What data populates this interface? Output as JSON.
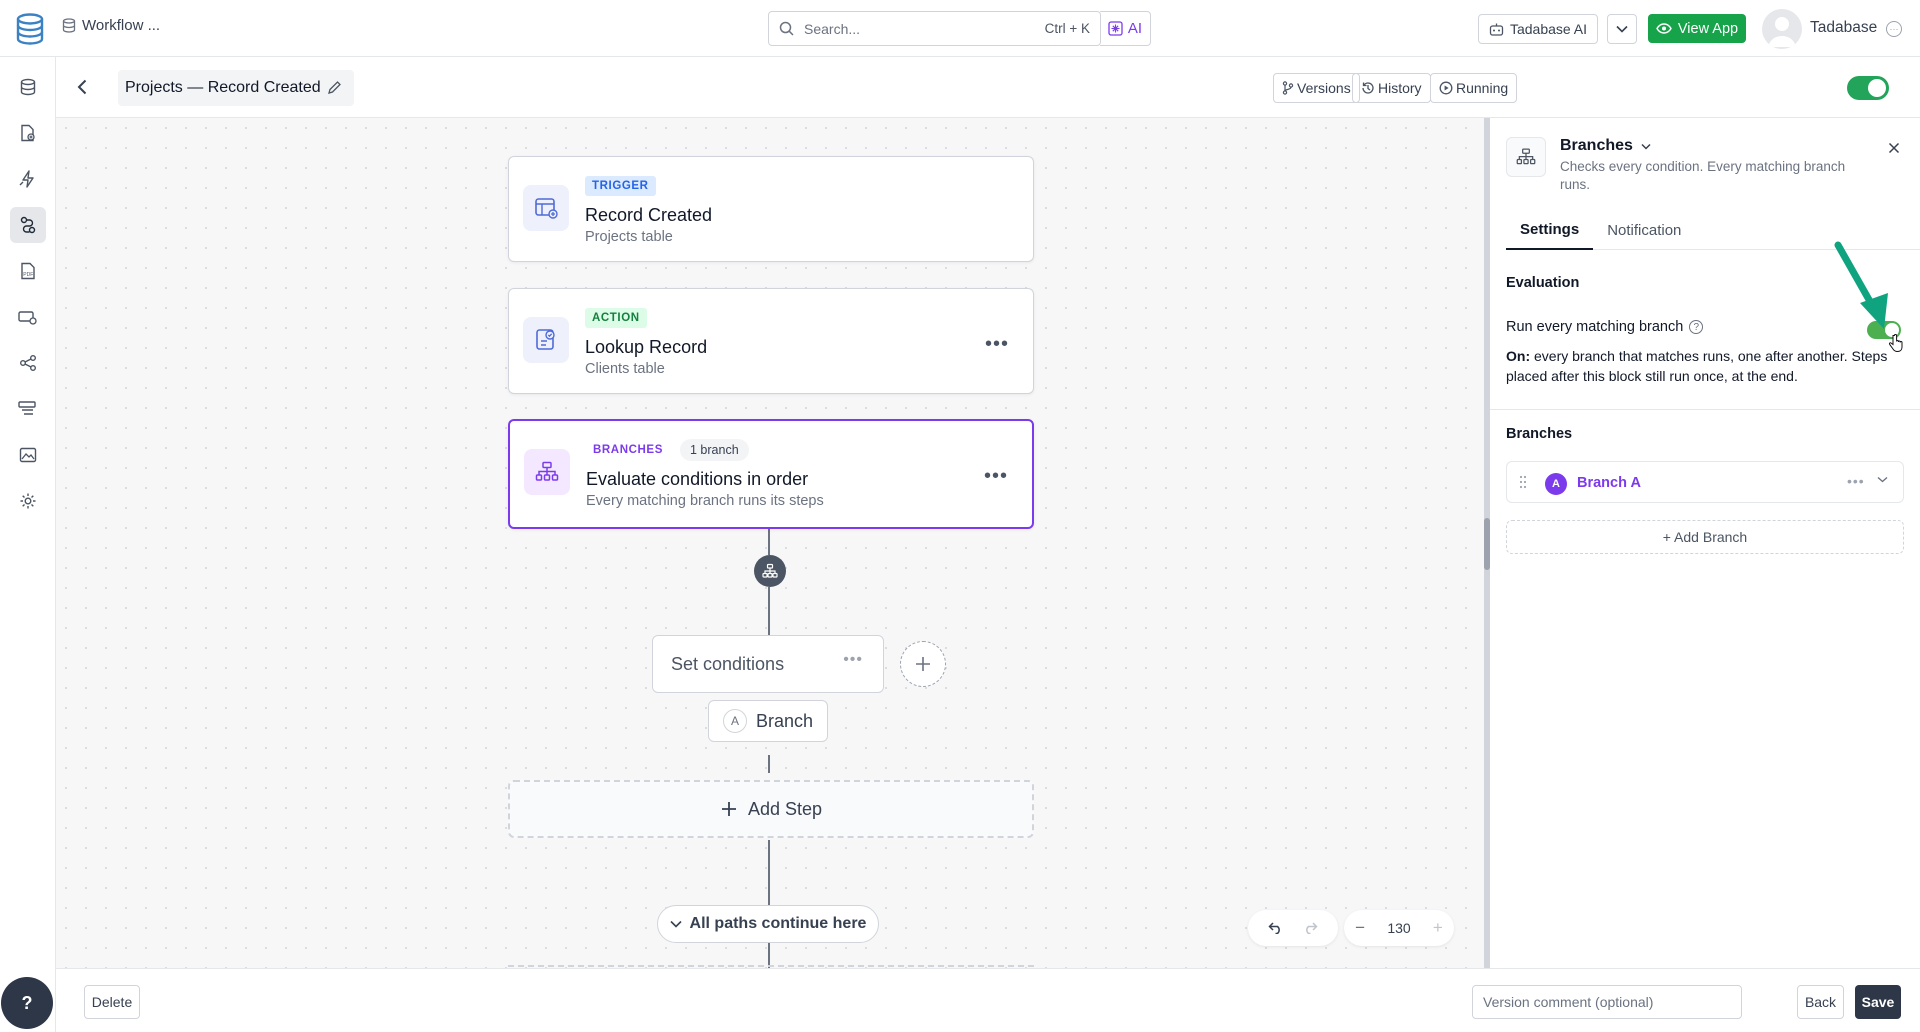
{
  "topbar": {
    "breadcrumb": "Workflow ...",
    "search_placeholder": "Search...",
    "search_shortcut": "Ctrl + K",
    "ai_label": "AI",
    "tadabase_ai_label": "Tadabase AI",
    "view_app_label": "View App",
    "user_name": "Tadabase"
  },
  "rail": {
    "items": [
      "database-icon",
      "page-add-icon",
      "automation-icon",
      "workflow-icon",
      "pdf-icon",
      "card-icon",
      "share-icon",
      "menu-icon",
      "image-icon",
      "settings-icon"
    ]
  },
  "subheader": {
    "title": "Projects — Record Created",
    "versions_label": "Versions",
    "history_label": "History",
    "running_label": "Running",
    "workflow_enabled": true
  },
  "canvas": {
    "trigger": {
      "badge": "TRIGGER",
      "title": "Record Created",
      "subtitle": "Projects table"
    },
    "action": {
      "badge": "ACTION",
      "title": "Lookup Record",
      "subtitle": "Clients table"
    },
    "branches": {
      "badge": "BRANCHES",
      "count": "1 branch",
      "title": "Evaluate conditions in order",
      "subtitle": "Every matching branch runs its steps"
    },
    "condition_label": "Set conditions",
    "branch_letter": "A",
    "branch_label": "Branch",
    "add_step_label": "Add Step",
    "merge_label": "All paths continue here",
    "zoom": "130"
  },
  "panel": {
    "title": "Branches",
    "description": "Checks every condition. Every matching branch runs.",
    "tabs": [
      "Settings",
      "Notification"
    ],
    "active_tab": "Settings",
    "evaluation_title": "Evaluation",
    "option_label": "Run every matching branch",
    "option_on": true,
    "option_desc_prefix": "On:",
    "option_desc": "every branch that matches runs, one after another. Steps placed after this block still run once, at the end.",
    "branches_title": "Branches",
    "branch_items": [
      {
        "letter": "A",
        "name": "Branch A"
      }
    ],
    "add_branch_label": "+ Add Branch"
  },
  "footer": {
    "delete_label": "Delete",
    "comment_placeholder": "Version comment (optional)",
    "back_label": "Back",
    "save_label": "Save"
  },
  "colors": {
    "accent_purple": "#7c3aed",
    "success_green": "#16a34a",
    "annotation_arrow": "#10a37f"
  }
}
